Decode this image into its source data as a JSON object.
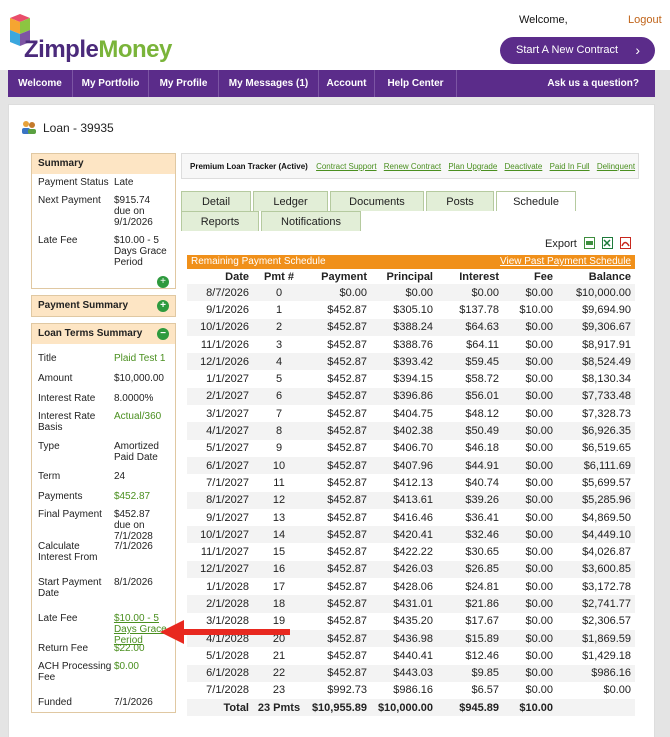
{
  "header": {
    "logo_word1": "Zimple",
    "logo_word2": "Money",
    "welcome": "Welcome,",
    "logout": "Logout",
    "start_button": "Start A New Contract",
    "start_chevron": "›"
  },
  "nav": {
    "items": [
      "Welcome",
      "My Portfolio",
      "My Profile",
      "My Messages (1)",
      "Account",
      "Help Center"
    ],
    "right": "Ask us a question?"
  },
  "loan_title": "Loan - 39935",
  "sidebar": {
    "summary_header": "Summary",
    "summary": [
      {
        "label": "Payment Status",
        "value": "Late"
      },
      {
        "label": "Next Payment",
        "value": "$915.74 due on 9/1/2026"
      },
      {
        "label": "Late Fee",
        "value": "$10.00 - 5 Days Grace Period"
      }
    ],
    "payment_summary_header": "Payment Summary",
    "loan_terms_header": "Loan Terms Summary",
    "terms": [
      {
        "label": "Title",
        "value": "Plaid Test 1"
      },
      {
        "label": "Amount",
        "value": "$10,000.00"
      },
      {
        "label": "Interest Rate",
        "value": "8.0000%"
      },
      {
        "label": "Interest Rate Basis",
        "value": "Actual/360"
      },
      {
        "label": "Type",
        "value": "Amortized Paid Date"
      },
      {
        "label": "Term",
        "value": "24"
      },
      {
        "label": "Payments",
        "value": "$452.87"
      },
      {
        "label": "Final Payment",
        "value": "$452.87 due on 7/1/2028"
      },
      {
        "label": "Calculate Interest From",
        "value": "7/1/2026"
      },
      {
        "label": "Start Payment Date",
        "value": "8/1/2026"
      },
      {
        "label": "Late Fee",
        "value": "$10.00 - 5 Days Grace Period"
      },
      {
        "label": "Return Fee",
        "value": "$22.00"
      },
      {
        "label": "ACH Processing Fee",
        "value": "$0.00"
      },
      {
        "label": "Funded",
        "value": "7/1/2026"
      }
    ]
  },
  "tracker": {
    "title": "Premium Loan Tracker (Active)",
    "links": [
      "Contract Support",
      "Renew Contract",
      "Plan Upgrade",
      "Deactivate",
      "Paid In Full",
      "Delinquent"
    ]
  },
  "tabs": [
    "Detail",
    "Ledger",
    "Documents",
    "Posts",
    "Schedule",
    "Reports",
    "Notifications"
  ],
  "schedule": {
    "export_label": "Export",
    "bar_left": "Remaining Payment Schedule",
    "bar_right": "View Past Payment Schedule",
    "headers": [
      "Date",
      "Pmt #",
      "Payment",
      "Principal",
      "Interest",
      "Fee",
      "Balance"
    ],
    "rows": [
      [
        "8/7/2026",
        "0",
        "$0.00",
        "$0.00",
        "$0.00",
        "$0.00",
        "$10,000.00"
      ],
      [
        "9/1/2026",
        "1",
        "$452.87",
        "$305.10",
        "$137.78",
        "$10.00",
        "$9,694.90"
      ],
      [
        "10/1/2026",
        "2",
        "$452.87",
        "$388.24",
        "$64.63",
        "$0.00",
        "$9,306.67"
      ],
      [
        "11/1/2026",
        "3",
        "$452.87",
        "$388.76",
        "$64.11",
        "$0.00",
        "$8,917.91"
      ],
      [
        "12/1/2026",
        "4",
        "$452.87",
        "$393.42",
        "$59.45",
        "$0.00",
        "$8,524.49"
      ],
      [
        "1/1/2027",
        "5",
        "$452.87",
        "$394.15",
        "$58.72",
        "$0.00",
        "$8,130.34"
      ],
      [
        "2/1/2027",
        "6",
        "$452.87",
        "$396.86",
        "$56.01",
        "$0.00",
        "$7,733.48"
      ],
      [
        "3/1/2027",
        "7",
        "$452.87",
        "$404.75",
        "$48.12",
        "$0.00",
        "$7,328.73"
      ],
      [
        "4/1/2027",
        "8",
        "$452.87",
        "$402.38",
        "$50.49",
        "$0.00",
        "$6,926.35"
      ],
      [
        "5/1/2027",
        "9",
        "$452.87",
        "$406.70",
        "$46.18",
        "$0.00",
        "$6,519.65"
      ],
      [
        "6/1/2027",
        "10",
        "$452.87",
        "$407.96",
        "$44.91",
        "$0.00",
        "$6,111.69"
      ],
      [
        "7/1/2027",
        "11",
        "$452.87",
        "$412.13",
        "$40.74",
        "$0.00",
        "$5,699.57"
      ],
      [
        "8/1/2027",
        "12",
        "$452.87",
        "$413.61",
        "$39.26",
        "$0.00",
        "$5,285.96"
      ],
      [
        "9/1/2027",
        "13",
        "$452.87",
        "$416.46",
        "$36.41",
        "$0.00",
        "$4,869.50"
      ],
      [
        "10/1/2027",
        "14",
        "$452.87",
        "$420.41",
        "$32.46",
        "$0.00",
        "$4,449.10"
      ],
      [
        "11/1/2027",
        "15",
        "$452.87",
        "$422.22",
        "$30.65",
        "$0.00",
        "$4,026.87"
      ],
      [
        "12/1/2027",
        "16",
        "$452.87",
        "$426.03",
        "$26.85",
        "$0.00",
        "$3,600.85"
      ],
      [
        "1/1/2028",
        "17",
        "$452.87",
        "$428.06",
        "$24.81",
        "$0.00",
        "$3,172.78"
      ],
      [
        "2/1/2028",
        "18",
        "$452.87",
        "$431.01",
        "$21.86",
        "$0.00",
        "$2,741.77"
      ],
      [
        "3/1/2028",
        "19",
        "$452.87",
        "$435.20",
        "$17.67",
        "$0.00",
        "$2,306.57"
      ],
      [
        "4/1/2028",
        "20",
        "$452.87",
        "$436.98",
        "$15.89",
        "$0.00",
        "$1,869.59"
      ],
      [
        "5/1/2028",
        "21",
        "$452.87",
        "$440.41",
        "$12.46",
        "$0.00",
        "$1,429.18"
      ],
      [
        "6/1/2028",
        "22",
        "$452.87",
        "$443.03",
        "$9.85",
        "$0.00",
        "$986.16"
      ],
      [
        "7/1/2028",
        "23",
        "$992.73",
        "$986.16",
        "$6.57",
        "$0.00",
        "$0.00"
      ]
    ],
    "total": [
      "Total",
      "23 Pmts",
      "$10,955.89",
      "$10,000.00",
      "$945.89",
      "$10.00",
      ""
    ]
  },
  "colors": {
    "purple": "#5b2c8a",
    "green": "#4a8f1f",
    "orange": "#f0901a",
    "arrow": "#e8281f"
  }
}
